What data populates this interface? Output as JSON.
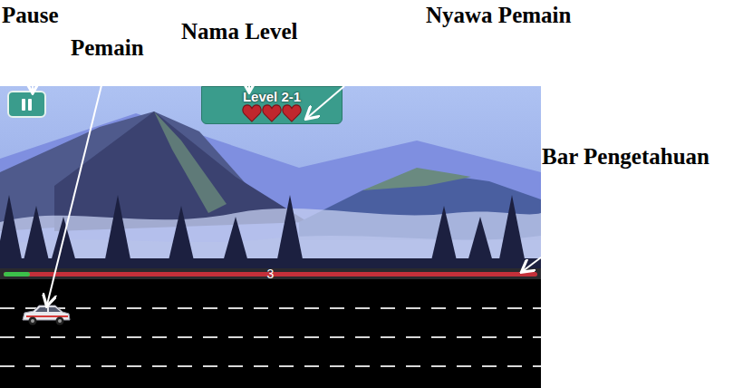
{
  "annotations": [
    {
      "label": "Pause"
    },
    {
      "label": "Pemain"
    },
    {
      "label": "Nama Level"
    },
    {
      "label": "Nyawa Pemain"
    },
    {
      "label": "Bar Pengetahuan"
    }
  ],
  "game": {
    "level_name": "Level 2-1",
    "lives": [
      {
        "filled": true
      },
      {
        "filled": true
      },
      {
        "filled": true
      }
    ],
    "knowledge_bar": {
      "level": 0.05,
      "reading": "3"
    }
  }
}
